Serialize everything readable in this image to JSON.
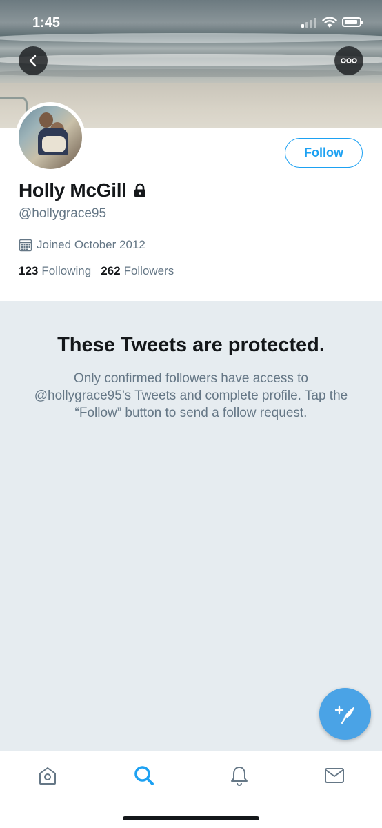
{
  "status_bar": {
    "time": "1:45"
  },
  "profile": {
    "name": "Holly McGill",
    "handle": "@hollygrace95",
    "joined": "Joined October 2012",
    "following_count": "123",
    "following_label": "Following",
    "followers_count": "262",
    "followers_label": "Followers",
    "follow_button_label": "Follow",
    "protected": true
  },
  "protected_notice": {
    "title": "These Tweets are protected.",
    "body": "Only confirmed followers have access to @hollygrace95’s Tweets and complete profile. Tap the “Follow” button to send a follow request."
  },
  "tabbar": {
    "items": [
      {
        "icon": "home-icon",
        "active": false
      },
      {
        "icon": "search-icon",
        "active": true
      },
      {
        "icon": "bell-icon",
        "active": false
      },
      {
        "icon": "mail-icon",
        "active": false
      }
    ]
  },
  "colors": {
    "accent": "#1da1f2",
    "fab": "#4aa3e6",
    "secondary_text": "#657786",
    "background": "#e6ecf0"
  }
}
